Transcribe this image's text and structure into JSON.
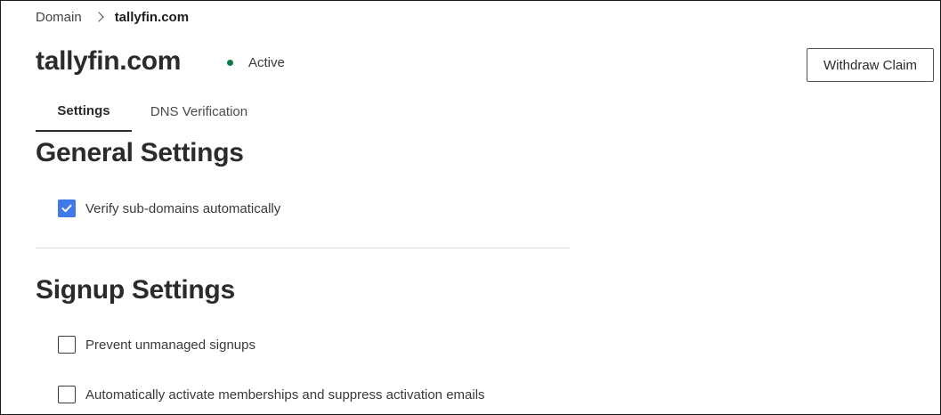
{
  "breadcrumb": {
    "root": "Domain",
    "current": "tallyfin.com"
  },
  "header": {
    "title": "tallyfin.com",
    "status": "Active",
    "status_color": "#0f7b4a",
    "withdraw_label": "Withdraw Claim"
  },
  "tabs": [
    {
      "label": "Settings",
      "active": true
    },
    {
      "label": "DNS Verification",
      "active": false
    }
  ],
  "general": {
    "title": "General Settings",
    "options": [
      {
        "label": "Verify sub-domains automatically",
        "checked": true
      }
    ]
  },
  "signup": {
    "title": "Signup Settings",
    "options": [
      {
        "label": "Prevent unmanaged signups",
        "checked": false
      },
      {
        "label": "Automatically activate memberships and suppress activation emails",
        "checked": false
      }
    ]
  },
  "colors": {
    "accent": "#3f7ae8",
    "text": "#2b2b2b"
  }
}
